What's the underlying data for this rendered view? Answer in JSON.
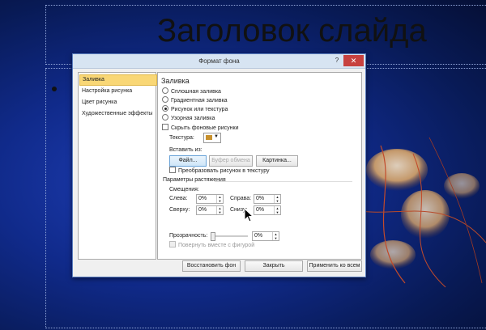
{
  "slide": {
    "title": "Заголовок слайда"
  },
  "dialog": {
    "title": "Формат фона",
    "help": "?",
    "close": "✕",
    "nav": [
      {
        "label": "Заливка",
        "selected": true
      },
      {
        "label": "Настройка рисунка",
        "selected": false
      },
      {
        "label": "Цвет рисунка",
        "selected": false
      },
      {
        "label": "Художественные эффекты",
        "selected": false
      }
    ],
    "fill": {
      "heading": "Заливка",
      "options": [
        {
          "label": "Сплошная заливка",
          "checked": false
        },
        {
          "label": "Градиентная заливка",
          "checked": false
        },
        {
          "label": "Рисунок или текстура",
          "checked": true
        },
        {
          "label": "Узорная заливка",
          "checked": false
        }
      ],
      "hide_bg": "Скрыть фоновые рисунки",
      "texture_label": "Текстура:",
      "insert_from": "Вставить из:",
      "btn_file": "Файл...",
      "btn_clipboard": "Буфер обмена",
      "btn_clipart": "Картинка...",
      "tile_label": "Преобразовать рисунок в текстуру",
      "stretch_heading": "Параметры растяжения",
      "offsets_label": "Смещения:",
      "left_label": "Слева:",
      "left_val": "0%",
      "right_label": "Справа:",
      "right_val": "0%",
      "top_label": "Сверху:",
      "top_val": "0%",
      "bottom_label": "Снизу:",
      "bottom_val": "0%",
      "transparency_label": "Прозрачность:",
      "transparency_val": "0%",
      "rotate_label": "Повернуть вместе с фигурой"
    },
    "footer": {
      "reset": "Восстановить фон",
      "close": "Закрыть",
      "apply_all": "Применить ко всем"
    }
  },
  "colors": {
    "selection": "#f9d776",
    "close_button": "#c7413f",
    "title_bar": "#d7e4f2"
  }
}
